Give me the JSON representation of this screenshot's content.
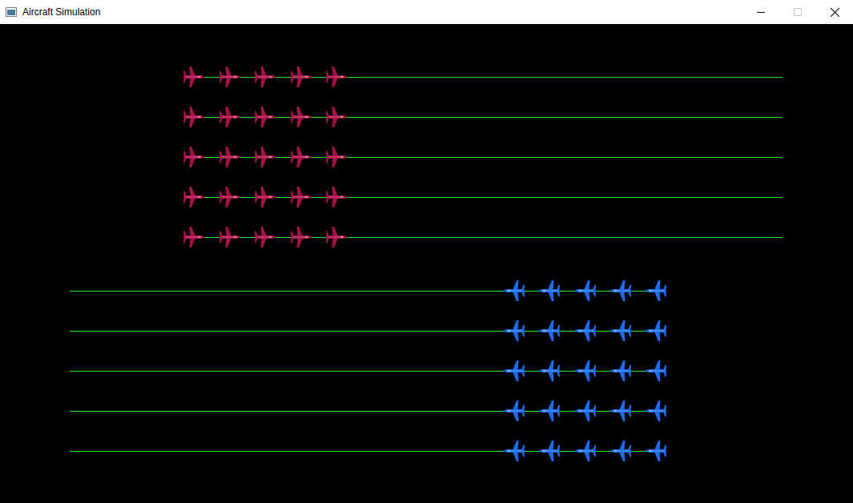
{
  "window": {
    "title": "Aircraft Simulation",
    "controls": [
      {
        "kind": "minimize",
        "disabled": false
      },
      {
        "kind": "maximize",
        "disabled": true
      },
      {
        "kind": "close",
        "disabled": false
      }
    ]
  },
  "formations": [
    {
      "heading": "east",
      "color": "#a8104a",
      "rows": [
        {
          "aircraft": 5
        },
        {
          "aircraft": 5
        },
        {
          "aircraft": 5
        },
        {
          "aircraft": 5
        },
        {
          "aircraft": 5
        }
      ]
    },
    {
      "heading": "west",
      "color": "#1a6cf0",
      "rows": [
        {
          "aircraft": 5
        },
        {
          "aircraft": 5
        },
        {
          "aircraft": 5
        },
        {
          "aircraft": 5
        },
        {
          "aircraft": 5
        }
      ]
    }
  ]
}
